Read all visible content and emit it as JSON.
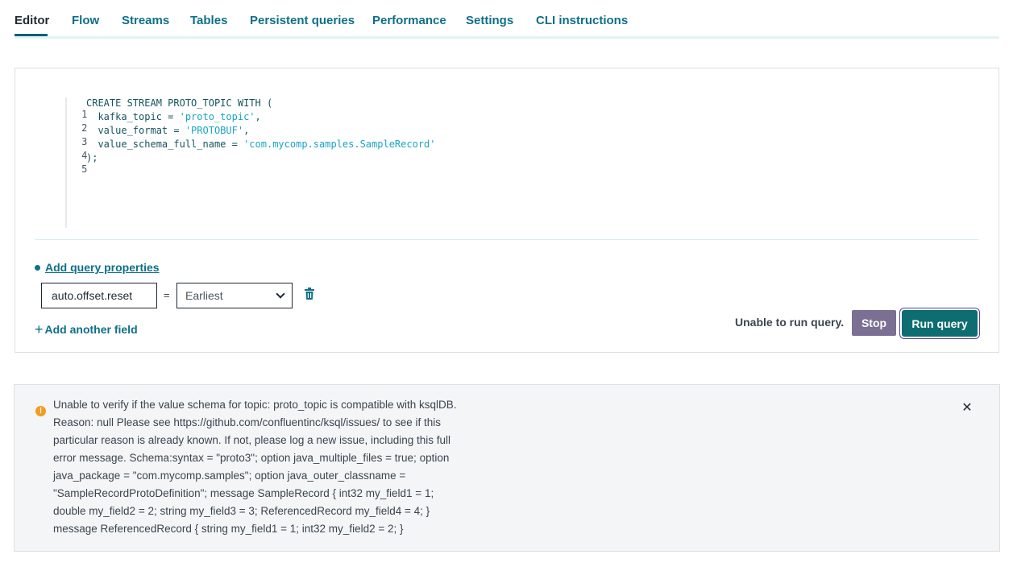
{
  "tabs": [
    {
      "label": "Editor",
      "active": true
    },
    {
      "label": "Flow"
    },
    {
      "label": "Streams"
    },
    {
      "label": "Tables"
    },
    {
      "label": "Persistent queries"
    },
    {
      "label": "Performance"
    },
    {
      "label": "Settings"
    },
    {
      "label": "CLI instructions"
    }
  ],
  "editor": {
    "line_numbers": [
      "1",
      "2",
      "3",
      "4",
      "5"
    ],
    "lines": [
      {
        "code": "CREATE STREAM PROTO_TOPIC WITH ("
      },
      {
        "code": "  kafka_topic = ",
        "string": "'proto_topic'",
        "tail": ","
      },
      {
        "code": "  value_format = ",
        "string": "'PROTOBUF'",
        "tail": ","
      },
      {
        "code": "  value_schema_full_name = ",
        "string": "'com.mycomp.samples.SampleRecord'",
        "tail": ""
      },
      {
        "code": ");"
      }
    ]
  },
  "query_properties": {
    "add_label": "Add query properties",
    "key": "auto.offset.reset",
    "equals": "=",
    "selected_value": "Earliest",
    "add_field_label": "Add another field"
  },
  "actions": {
    "status": "Unable to run query.",
    "stop_label": "Stop",
    "run_label": "Run query"
  },
  "alert": {
    "lines": [
      "Unable to verify if the value schema for topic: proto_topic is compatible with ksqlDB.",
      "Reason: null Please see https://github.com/confluentinc/ksql/issues/ to see if this",
      "particular reason is already known. If not, please log a new issue, including this full",
      "error message. Schema:syntax = \"proto3\"; option java_multiple_files = true; option",
      "java_package = \"com.mycomp.samples\"; option java_outer_classname =",
      "\"SampleRecordProtoDefinition\"; message SampleRecord { int32 my_field1 = 1;",
      "double my_field2 = 2; string my_field3 = 3; ReferencedRecord my_field4 = 4; }",
      "message ReferencedRecord { string my_field1 = 1; int32 my_field2 = 2; }"
    ],
    "icon": "warning-icon",
    "close_icon": "close-icon"
  },
  "colors": {
    "accent": "#0f6f89",
    "run_button": "#0d6d70",
    "stop_button": "#7b6f94",
    "warning": "#f29b1f"
  }
}
